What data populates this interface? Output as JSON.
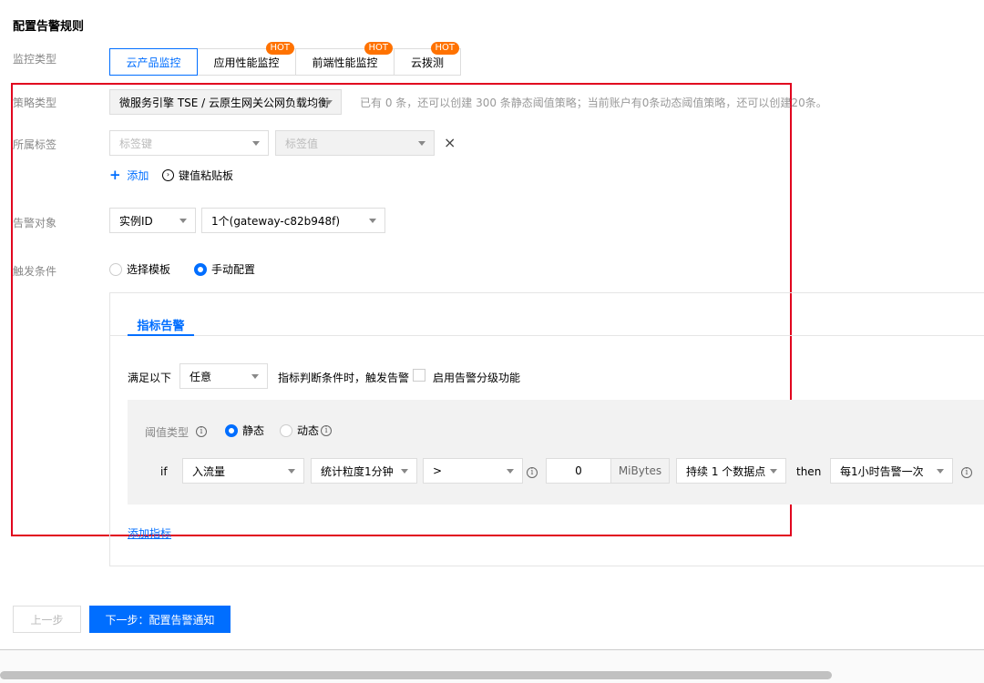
{
  "title": "配置告警规则",
  "labels": {
    "monitor_type": "监控类型",
    "policy_type": "策略类型",
    "tags": "所属标签",
    "target": "告警对象",
    "trigger": "触发条件"
  },
  "tabs": [
    {
      "label": "云产品监控",
      "active": true,
      "hot": false
    },
    {
      "label": "应用性能监控",
      "active": false,
      "hot": true
    },
    {
      "label": "前端性能监控",
      "active": false,
      "hot": true
    },
    {
      "label": "云拨测",
      "active": false,
      "hot": true
    }
  ],
  "hot_badge": "HOT",
  "policy": {
    "value": "微服务引擎 TSE / 云原生网关公网负载均衡",
    "hint": "已有 0 条，还可以创建 300 条静态阈值策略；当前账户有0条动态阈值策略，还可以创建20条。"
  },
  "tag_row": {
    "key_placeholder": "标签键",
    "value_placeholder": "标签值",
    "close": "×",
    "add": "添加",
    "add_plus": "+",
    "paste": "键值粘贴板"
  },
  "target": {
    "type": "实例ID",
    "value": "1个(gateway-c82b948f)"
  },
  "trigger": {
    "option_template": "选择模板",
    "option_manual": "手动配置"
  },
  "metric_panel": {
    "tab": "指标告警",
    "satisfy_prefix": "满足以下",
    "satisfy_select": "任意",
    "satisfy_suffix": "指标判断条件时，触发告警",
    "level_checkbox": "启用告警分级功能",
    "threshold_label": "阈值类型",
    "static": "静态",
    "dynamic": "动态",
    "rule": {
      "if": "if",
      "metric": "入流量",
      "granularity": "统计粒度1分钟",
      "operator": ">",
      "value": "0",
      "unit": "MiBytes",
      "duration": "持续 1 个数据点",
      "then": "then",
      "frequency": "每1小时告警一次"
    },
    "add_metric": "添加指标"
  },
  "footer": {
    "prev": "上一步",
    "next": "下一步：配置告警通知"
  },
  "colors": {
    "primary": "#006eff",
    "hot": "#ff7200",
    "highlight_border": "#e1001e"
  }
}
